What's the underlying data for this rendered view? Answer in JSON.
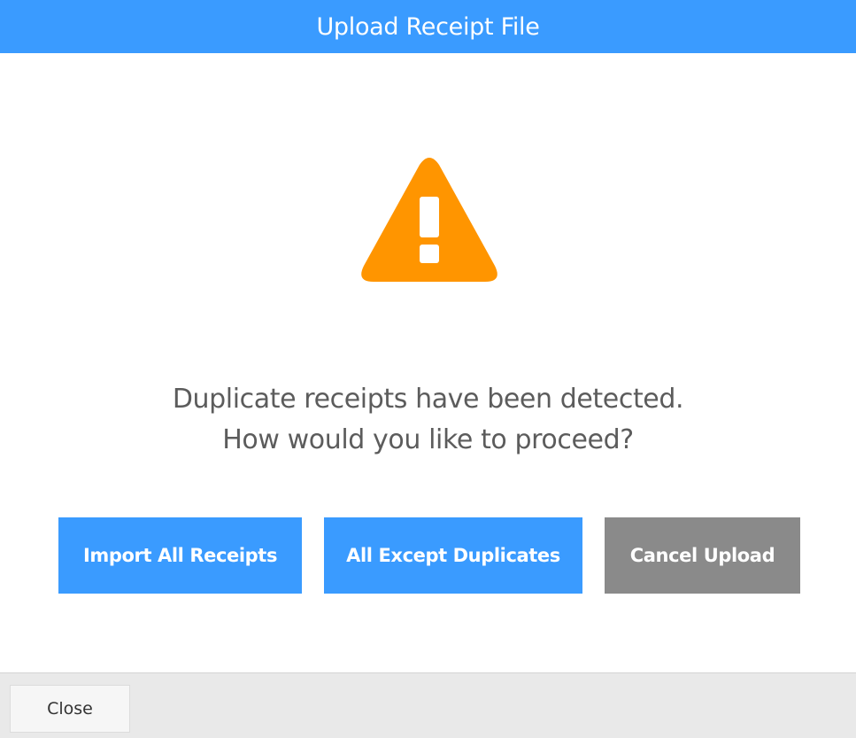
{
  "dialog": {
    "title": "Upload Receipt File",
    "icon": "warning-icon",
    "message_line1": "Duplicate receipts have been detected.",
    "message_line2": "How would you like to proceed?"
  },
  "actions": {
    "import_all_label": "Import All Receipts",
    "all_except_duplicates_label": "All Except Duplicates",
    "cancel_upload_label": "Cancel Upload"
  },
  "footer": {
    "close_label": "Close"
  },
  "colors": {
    "header": "#3a9bff",
    "primary_button": "#3a9bff",
    "secondary_button": "#8a8a8a",
    "warning": "#ff9500",
    "footer": "#e9e9e9"
  }
}
